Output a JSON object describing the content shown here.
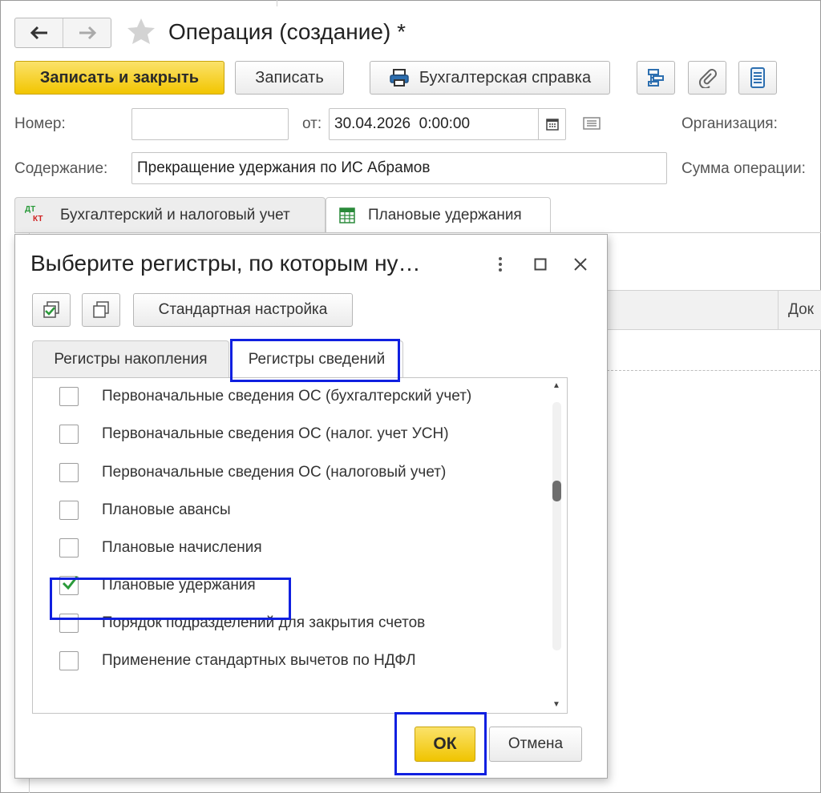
{
  "window": {
    "title": "Операция (создание) *"
  },
  "toolbar": {
    "save_close_label": "Записать и закрыть",
    "save_label": "Записать",
    "report_label": "Бухгалтерская справка"
  },
  "form": {
    "number_label": "Номер:",
    "number_value": "",
    "from_label": "от:",
    "date_value": "30.04.2026  0:00:00",
    "organization_label": "Организация:",
    "content_label": "Содержание:",
    "content_value": "Прекращение удержания по ИС Абрамов",
    "sum_label": "Сумма операции:"
  },
  "tabs": [
    {
      "label": "Бухгалтерский и налоговый учет",
      "icon_text_top": "ДТ",
      "icon_text_bottom": "КТ",
      "active": false
    },
    {
      "label": "Плановые удержания",
      "active": true
    }
  ],
  "background_table": {
    "column_doc_label": "Док"
  },
  "dialog": {
    "title": "Выберите регистры, по которым ну…",
    "standard_settings_label": "Стандартная настройка",
    "tabs": [
      {
        "label": "Регистры накопления",
        "active": false
      },
      {
        "label": "Регистры сведений",
        "active": true
      }
    ],
    "items": [
      {
        "label": "Первоначальные сведения ОС (бухгалтерский учет)",
        "checked": false
      },
      {
        "label": "Первоначальные сведения ОС (налог. учет УСН)",
        "checked": false
      },
      {
        "label": "Первоначальные сведения ОС (налоговый учет)",
        "checked": false
      },
      {
        "label": "Плановые авансы",
        "checked": false
      },
      {
        "label": "Плановые начисления",
        "checked": false
      },
      {
        "label": "Плановые удержания",
        "checked": true
      },
      {
        "label": "Порядок подразделений для закрытия счетов",
        "checked": false
      },
      {
        "label": "Применение стандартных вычетов по НДФЛ",
        "checked": false
      }
    ],
    "ok_label": "ОК",
    "cancel_label": "Отмена"
  },
  "colors": {
    "primary_button": "#f2c500",
    "highlight": "#1020e0",
    "check": "#2a9a3a"
  }
}
